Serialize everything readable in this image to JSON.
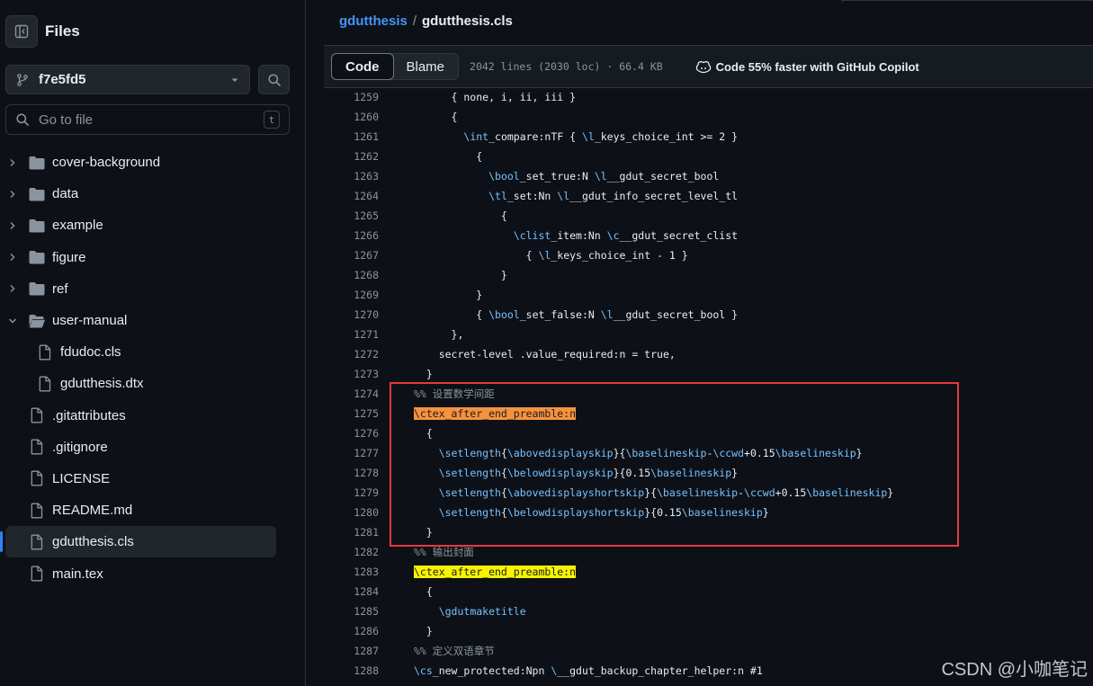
{
  "sidebar": {
    "title": "Files",
    "branch": "f7e5fd5",
    "goto_placeholder": "Go to file",
    "goto_shortcut": "t",
    "items": [
      {
        "label": "cover-background",
        "kind": "folder",
        "expandable": true
      },
      {
        "label": "data",
        "kind": "folder",
        "expandable": true
      },
      {
        "label": "example",
        "kind": "folder",
        "expandable": true
      },
      {
        "label": "figure",
        "kind": "folder",
        "expandable": true
      },
      {
        "label": "ref",
        "kind": "folder",
        "expandable": true
      },
      {
        "label": "user-manual",
        "kind": "folder-open",
        "expandable": true
      },
      {
        "label": "fdudoc.cls",
        "kind": "file",
        "indent": true
      },
      {
        "label": "gdutthesis.dtx",
        "kind": "file",
        "indent": true
      },
      {
        "label": ".gitattributes",
        "kind": "file"
      },
      {
        "label": ".gitignore",
        "kind": "file"
      },
      {
        "label": "LICENSE",
        "kind": "file"
      },
      {
        "label": "README.md",
        "kind": "file"
      },
      {
        "label": "gdutthesis.cls",
        "kind": "file",
        "selected": true
      },
      {
        "label": "main.tex",
        "kind": "file"
      }
    ]
  },
  "breadcrumb": {
    "repo": "gdutthesis",
    "separator": "/",
    "file": "gdutthesis.cls"
  },
  "file_header": {
    "tab_code": "Code",
    "tab_blame": "Blame",
    "meta": "2042 lines (2030 loc) · 66.4 KB",
    "copilot": "Code 55% faster with GitHub Copilot"
  },
  "code_lines": [
    {
      "n": "1259",
      "c": "      { none, i, ii, iii }"
    },
    {
      "n": "1260",
      "c": "      {"
    },
    {
      "n": "1261",
      "c": "        \\int_compare:nTF { \\l_keys_choice_int >= 2 }"
    },
    {
      "n": "1262",
      "c": "          {"
    },
    {
      "n": "1263",
      "c": "            \\bool_set_true:N \\l__gdut_secret_bool"
    },
    {
      "n": "1264",
      "c": "            \\tl_set:Nn \\l__gdut_info_secret_level_tl"
    },
    {
      "n": "1265",
      "c": "              {"
    },
    {
      "n": "1266",
      "c": "                \\clist_item:Nn \\c__gdut_secret_clist"
    },
    {
      "n": "1267",
      "c": "                  { \\l_keys_choice_int - 1 }"
    },
    {
      "n": "1268",
      "c": "              }"
    },
    {
      "n": "1269",
      "c": "          }"
    },
    {
      "n": "1270",
      "c": "          { \\bool_set_false:N \\l__gdut_secret_bool }"
    },
    {
      "n": "1271",
      "c": "      },"
    },
    {
      "n": "1272",
      "c": "    secret-level .value_required:n = true,"
    },
    {
      "n": "1273",
      "c": "  }"
    },
    {
      "n": "1274",
      "c": "%% 设置数学间距"
    },
    {
      "n": "1275",
      "c": "\\ctex_after_end_preamble:n"
    },
    {
      "n": "1276",
      "c": "  {"
    },
    {
      "n": "1277",
      "c": "    \\setlength{\\abovedisplayskip}{\\baselineskip-\\ccwd+0.15\\baselineskip}"
    },
    {
      "n": "1278",
      "c": "    \\setlength{\\belowdisplayskip}{0.15\\baselineskip}"
    },
    {
      "n": "1279",
      "c": "    \\setlength{\\abovedisplayshortskip}{\\baselineskip-\\ccwd+0.15\\baselineskip}"
    },
    {
      "n": "1280",
      "c": "    \\setlength{\\belowdisplayshortskip}{0.15\\baselineskip}"
    },
    {
      "n": "1281",
      "c": "  }"
    },
    {
      "n": "1282",
      "c": "%% 输出封面"
    },
    {
      "n": "1283",
      "c": "\\ctex_after_end_preamble:n"
    },
    {
      "n": "1284",
      "c": "  {"
    },
    {
      "n": "1285",
      "c": "    \\gdutmaketitle"
    },
    {
      "n": "1286",
      "c": "  }"
    },
    {
      "n": "1287",
      "c": "%% 定义双语章节"
    },
    {
      "n": "1288",
      "c": "\\cs_new_protected:Npn \\__gdut_backup_chapter_helper:n #1"
    }
  ],
  "highlights": {
    "orange_line": "1275",
    "yellow_line": "1283"
  },
  "colors": {
    "accent": "#4493f8",
    "orange_highlight": "#f6913e",
    "yellow_highlight": "#f7f300",
    "annotation_box": "#e5383b"
  },
  "watermark": "CSDN @小咖笔记"
}
